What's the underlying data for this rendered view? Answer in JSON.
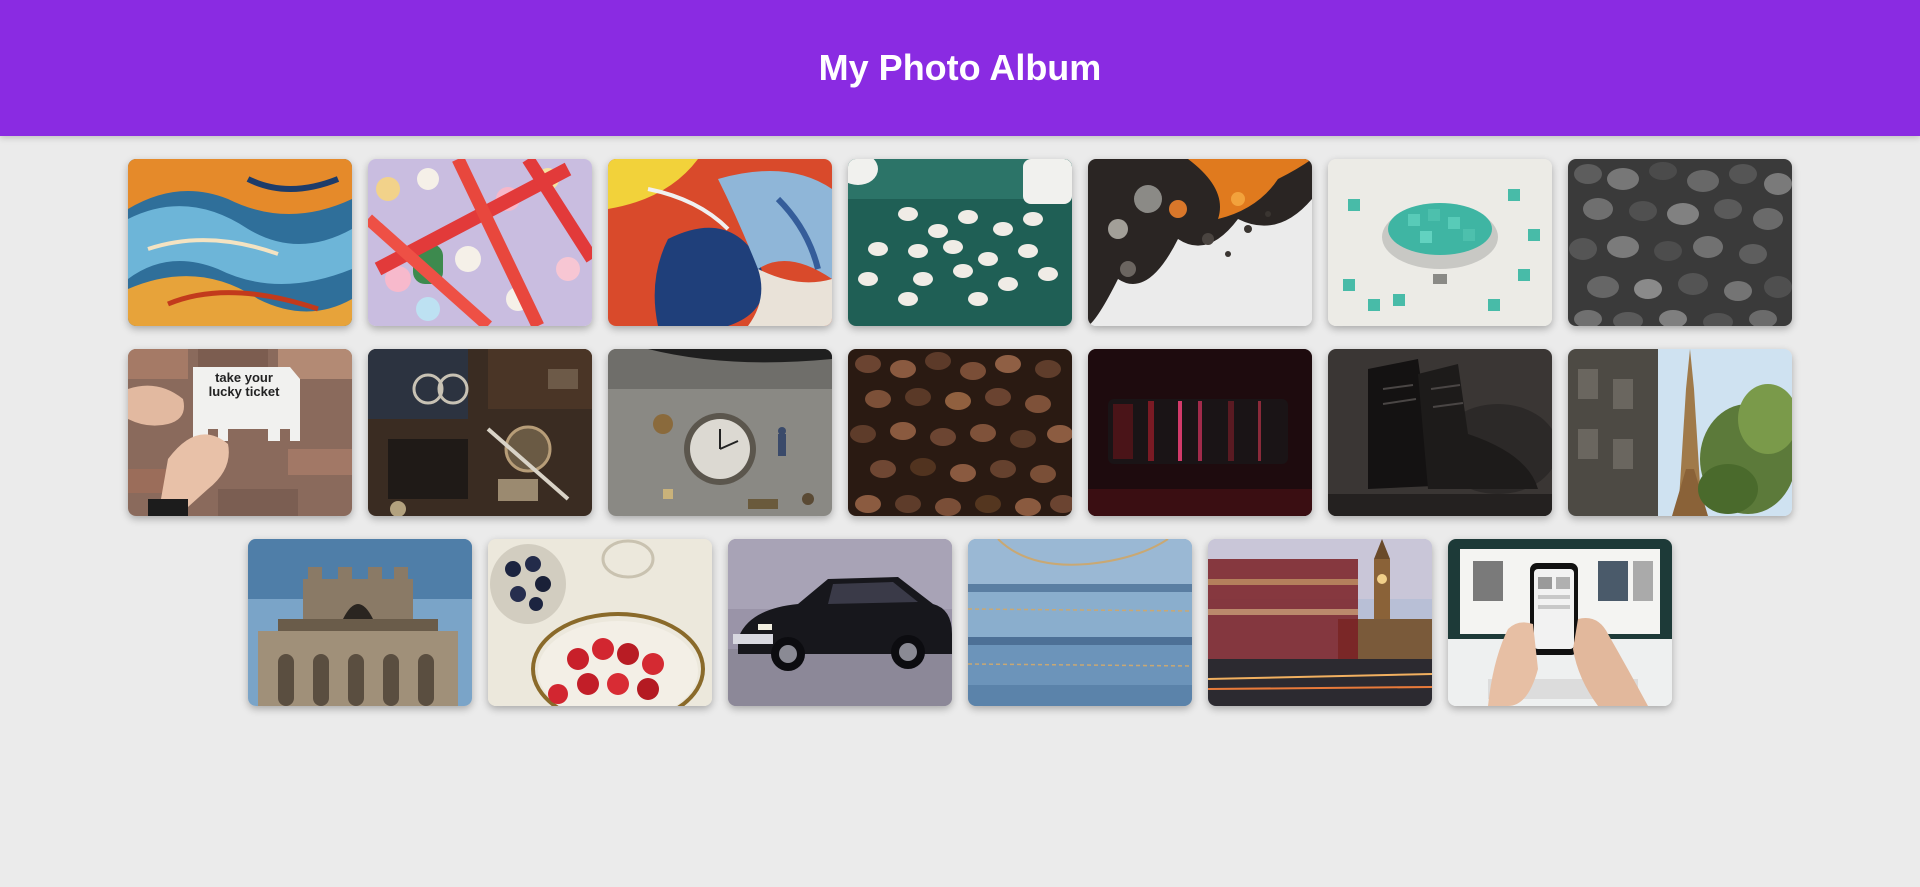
{
  "header": {
    "title": "My Photo Album",
    "background": "#8a2be2"
  },
  "gallery": {
    "photos": [
      {
        "subject": "fluid-art-orange-blue"
      },
      {
        "subject": "candy-sweets"
      },
      {
        "subject": "fluid-art-red-blue"
      },
      {
        "subject": "white-pills-on-green"
      },
      {
        "subject": "abstract-ink-splash"
      },
      {
        "subject": "letter-tiles-in-bowl"
      },
      {
        "subject": "grey-pebbles"
      },
      {
        "subject": "lucky-ticket-on-brick-wall",
        "sign_text_1": "take your",
        "sign_text_2": "lucky ticket"
      },
      {
        "subject": "flea-market-trinkets"
      },
      {
        "subject": "pocket-watch-on-stone"
      },
      {
        "subject": "coffee-beans"
      },
      {
        "subject": "camera-lens-dark"
      },
      {
        "subject": "black-leather-boots"
      },
      {
        "subject": "eiffel-tower-street"
      },
      {
        "subject": "tower-building-sky"
      },
      {
        "subject": "blueberries-and-strawberries"
      },
      {
        "subject": "black-sedan-car"
      },
      {
        "subject": "folded-jeans"
      },
      {
        "subject": "big-ben-bus-motion"
      },
      {
        "subject": "hands-holding-smartphone"
      }
    ]
  }
}
